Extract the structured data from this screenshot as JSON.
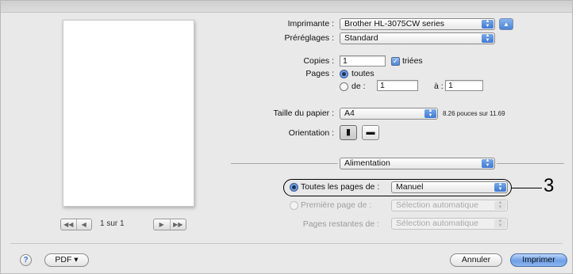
{
  "print_dialog": {
    "printer_label": "Imprimante :",
    "printer_value": "Brother HL-3075CW series",
    "presets_label": "Préréglages :",
    "presets_value": "Standard",
    "copies_label": "Copies :",
    "copies_value": "1",
    "collated_label": "triées",
    "pages_label": "Pages :",
    "pages_all_label": "toutes",
    "pages_from_label": "de :",
    "pages_from_value": "1",
    "pages_to_label": "à :",
    "pages_to_value": "1",
    "paper_size_label": "Taille du papier :",
    "paper_size_value": "A4",
    "paper_size_info": "8.26 pouces sur 11.69",
    "orientation_label": "Orientation :",
    "section_value": "Alimentation",
    "all_pages_from_label": "Toutes les pages de :",
    "all_pages_from_value": "Manuel",
    "first_page_from_label": "Première page de :",
    "first_page_from_value": "Sélection automatique",
    "remaining_pages_from_label": "Pages restantes de :",
    "remaining_pages_from_value": "Sélection automatique"
  },
  "preview": {
    "page_indicator": "1 sur 1",
    "first_btn": "◀◀",
    "prev_btn": "◀",
    "next_btn": "▶",
    "last_btn": "▶▶"
  },
  "footer": {
    "help_label": "?",
    "pdf_label": "PDF ▾",
    "cancel_label": "Annuler",
    "print_label": "Imprimer"
  },
  "callout": {
    "number": "3"
  },
  "icons": {
    "popup_arrows": "▲▼",
    "collapse": "▲",
    "checkmark": "✓",
    "portrait": "▮",
    "landscape": "▬"
  }
}
